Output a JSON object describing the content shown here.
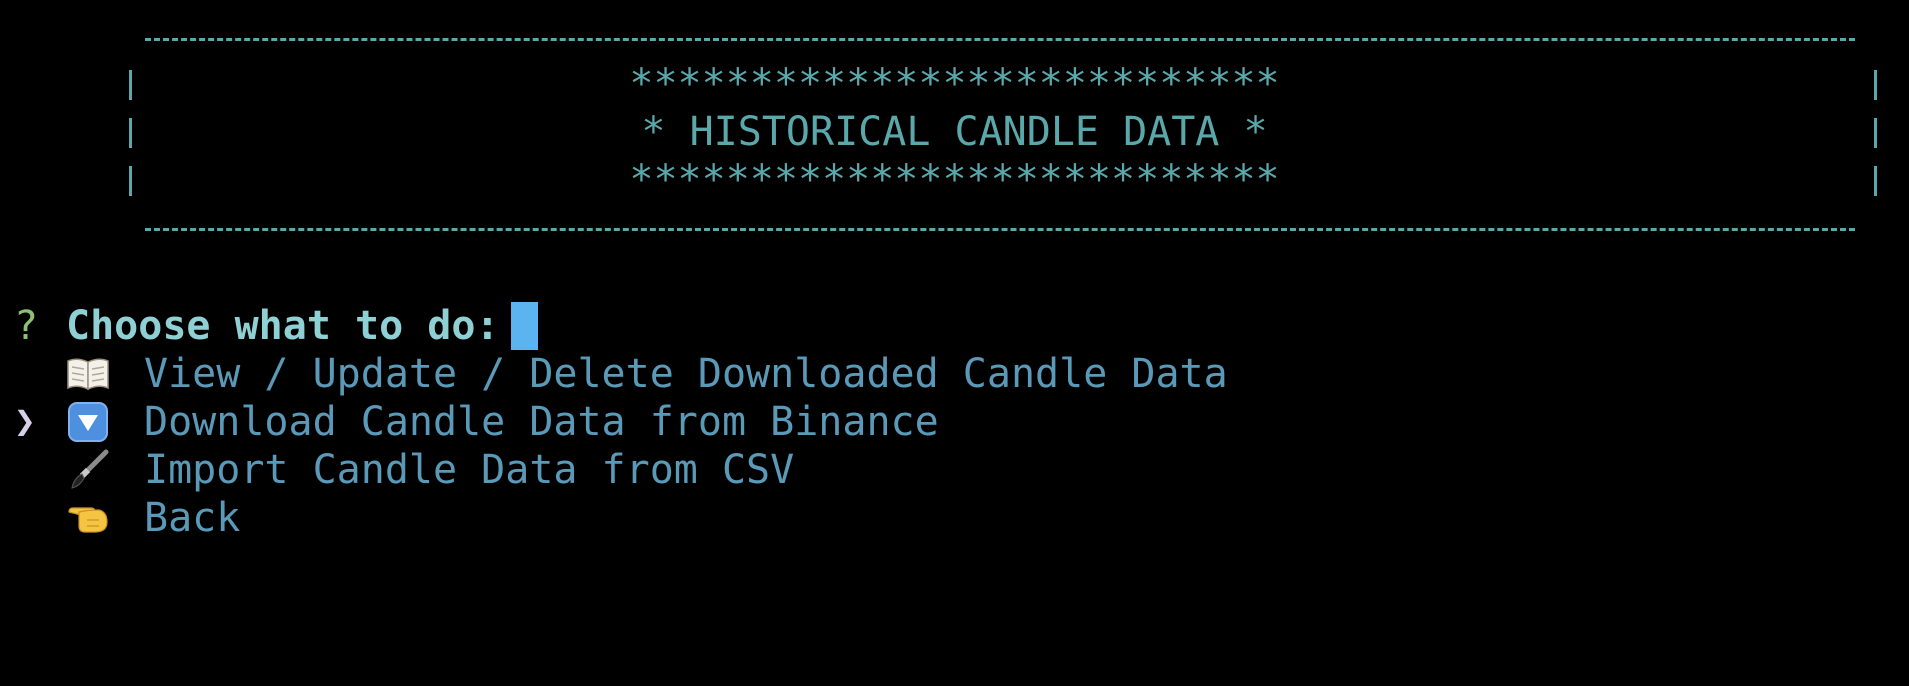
{
  "banner": {
    "stars_top": "***************************",
    "title": "* HISTORICAL CANDLE DATA *",
    "stars_bottom": "***************************"
  },
  "prompt": {
    "marker": "?",
    "question": "Choose what to do:"
  },
  "menu": {
    "pointer": "❯",
    "items": [
      {
        "icon": "open-book-icon",
        "label": "View / Update / Delete Downloaded Candle Data",
        "selected": false
      },
      {
        "icon": "down-arrow-box-icon",
        "label": "Download Candle Data from Binance",
        "selected": true
      },
      {
        "icon": "paintbrush-icon",
        "label": "Import Candle Data from CSV",
        "selected": false
      },
      {
        "icon": "pointing-hand-left-icon",
        "label": "Back",
        "selected": false
      }
    ]
  },
  "colors": {
    "background": "#000000",
    "text": "#5ba8ab",
    "prompt": "#8fd0d4",
    "qmark": "#8fbf76",
    "cursor": "#5bb4f0",
    "menu_text": "#5a9ab8"
  }
}
